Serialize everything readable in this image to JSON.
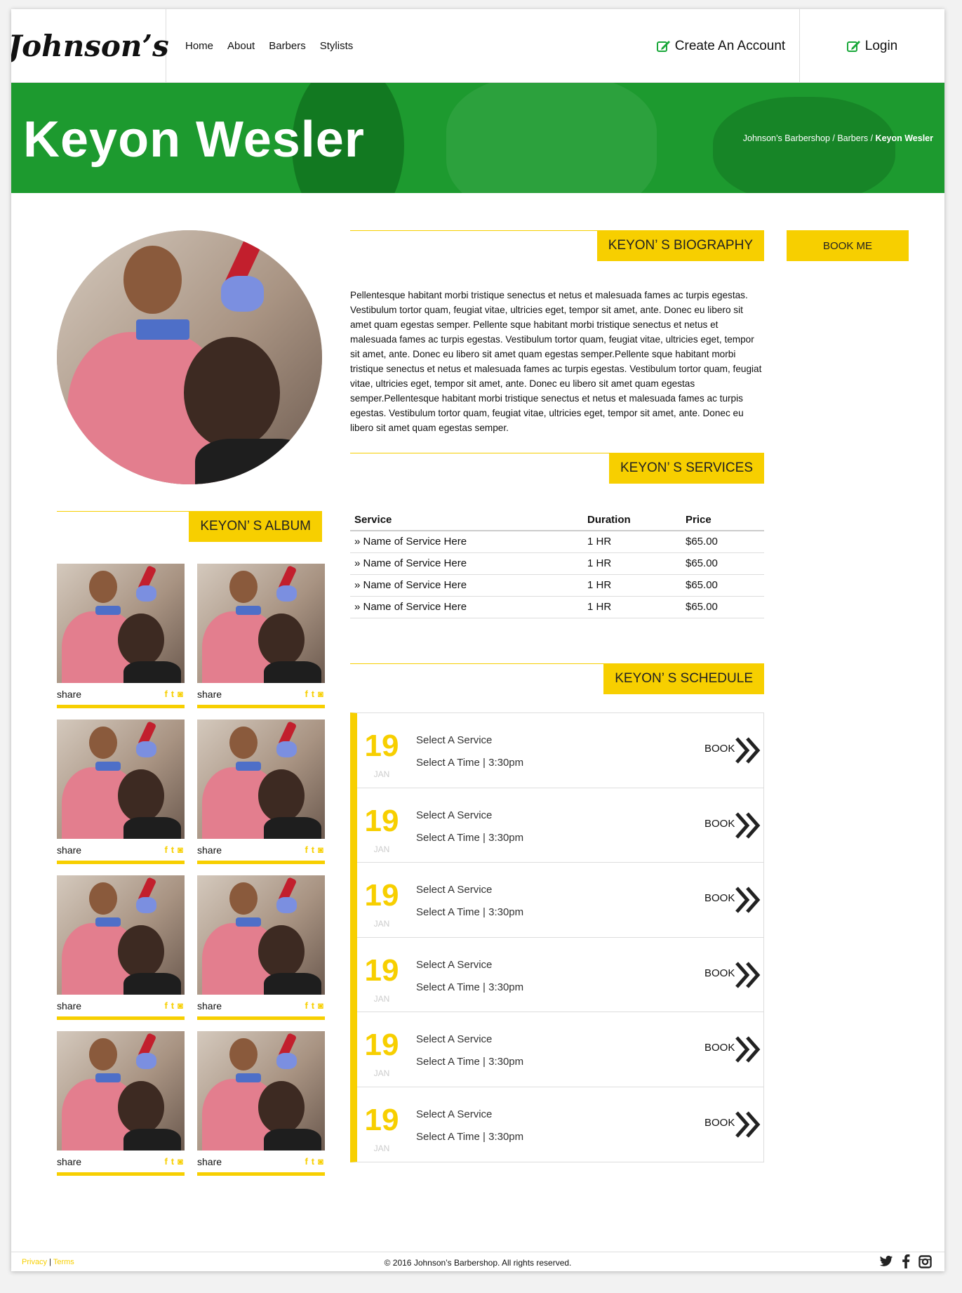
{
  "brand": {
    "logo": "Johnson’s"
  },
  "nav": {
    "items": [
      "Home",
      "About",
      "Barbers",
      "Stylists"
    ]
  },
  "header": {
    "create_account": "Create An Account",
    "login": "Login",
    "icon": "edit-icon"
  },
  "hero": {
    "title": "Keyon Wesler",
    "breadcrumb": {
      "home": "Johnson’s Barbershop",
      "sep1": " / ",
      "section": "Barbers",
      "sep2": " / ",
      "current": "Keyon Wesler"
    }
  },
  "biography": {
    "heading": "KEYON’ S BIOGRAPHY",
    "text": "Pellentesque habitant morbi tristique senectus et netus et malesuada fames ac turpis egestas. Vestibulum tortor quam, feugiat vitae, ultricies eget, tempor sit amet, ante. Donec eu libero sit amet quam egestas semper. Pellente sque habitant morbi tristique senectus et netus et malesuada fames ac turpis egestas. Vestibulum tortor quam, feugiat vitae, ultricies eget, tempor sit amet, ante. Donec eu libero sit amet quam egestas semper.Pellente sque habitant morbi tristique senectus et netus et malesuada fames ac turpis egestas. Vestibulum tortor quam, feugiat vitae, ultricies eget, tempor sit amet, ante. Donec eu libero sit amet quam egestas semper.Pellentesque habitant morbi tristique senectus et netus et malesuada fames ac turpis egestas. Vestibulum tortor quam, feugiat vitae, ultricies eget, tempor sit amet, ante. Donec eu libero sit amet quam egestas semper."
  },
  "book_me": "BOOK ME",
  "services": {
    "heading": "KEYON’ S SERVICES",
    "columns": [
      "Service",
      "Duration",
      "Price"
    ],
    "rows": [
      [
        "» Name of Service Here",
        "1 HR",
        "$65.00"
      ],
      [
        "» Name of Service Here",
        "1 HR",
        "$65.00"
      ],
      [
        "» Name of Service Here",
        "1 HR",
        "$65.00"
      ],
      [
        "» Name of Service Here",
        "1 HR",
        "$65.00"
      ]
    ]
  },
  "album": {
    "heading": "KEYON’ S ALBUM",
    "share_label": "share",
    "count": 8
  },
  "schedule": {
    "heading": "KEYON’ S SCHEDULE",
    "rows": [
      {
        "day": "19",
        "month": "JAN",
        "service": "Select A Service",
        "time": "Select A Time | 3:30pm",
        "book": "BOOK"
      },
      {
        "day": "19",
        "month": "JAN",
        "service": "Select A Service",
        "time": "Select A Time | 3:30pm",
        "book": "BOOK"
      },
      {
        "day": "19",
        "month": "JAN",
        "service": "Select A Service",
        "time": "Select A Time | 3:30pm",
        "book": "BOOK"
      },
      {
        "day": "19",
        "month": "JAN",
        "service": "Select A Service",
        "time": "Select A Time | 3:30pm",
        "book": "BOOK"
      },
      {
        "day": "19",
        "month": "JAN",
        "service": "Select A Service",
        "time": "Select A Time | 3:30pm",
        "book": "BOOK"
      },
      {
        "day": "19",
        "month": "JAN",
        "service": "Select A Service",
        "time": "Select A Time | 3:30pm",
        "book": "BOOK"
      }
    ]
  },
  "footer": {
    "privacy": "Privacy",
    "separator": "|",
    "terms": "Terms",
    "copyright": "© 2016 Johnson’s Barbershop. All rights reserved.",
    "social_icons": [
      "twitter-icon",
      "facebook-icon",
      "instagram-icon"
    ]
  },
  "colors": {
    "accent": "#f7cf00",
    "hero_green": "#1d9a2f",
    "icon_green": "#1aa83a"
  }
}
